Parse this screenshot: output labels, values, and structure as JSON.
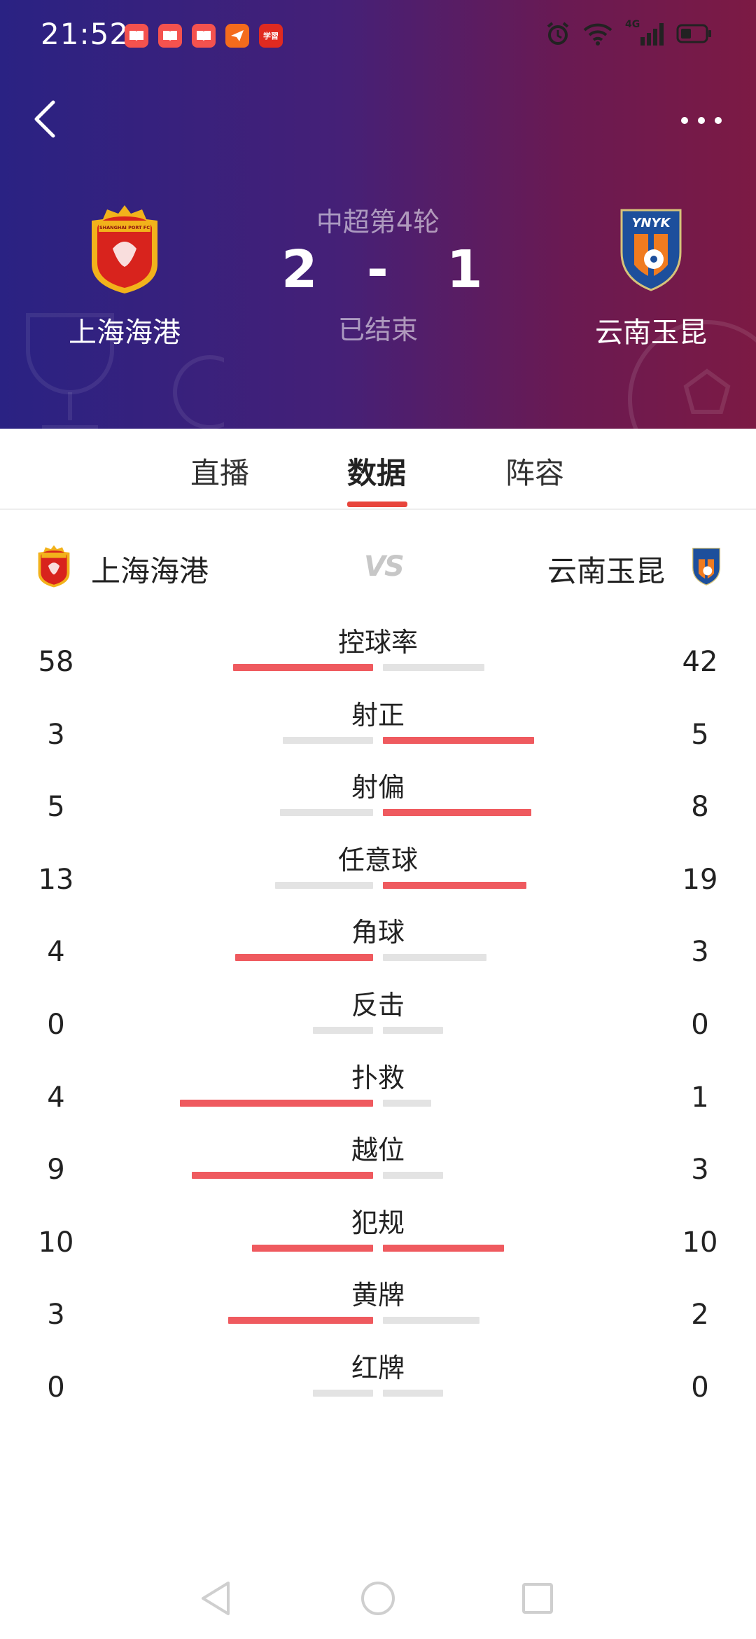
{
  "status_bar": {
    "time": "21:52",
    "app_icons": [
      "book-app-icon",
      "book-app-icon",
      "book-app-icon",
      "send-app-icon",
      "study-app-icon"
    ],
    "study_icon_text": "学習",
    "network": "4G"
  },
  "header": {
    "round": "中超第4轮",
    "home_score": "2",
    "dash": "-",
    "away_score": "1",
    "status": "已结束",
    "home_team": "上海海港",
    "away_team": "云南玉昆",
    "home_crest_text": "SHANGHAI PORT FC",
    "away_crest_text": "YNYK"
  },
  "tabs": [
    {
      "label": "直播",
      "active": false
    },
    {
      "label": "数据",
      "active": true
    },
    {
      "label": "阵容",
      "active": false
    }
  ],
  "comparison": {
    "home_team": "上海海港",
    "vs": "VS",
    "away_team": "云南玉昆"
  },
  "stats": [
    {
      "label": "控球率",
      "home": 58,
      "away": 42,
      "home_bar": 0.58,
      "away_bar": 0.42
    },
    {
      "label": "射正",
      "home": 3,
      "away": 5,
      "home_bar": 0.375,
      "away_bar": 0.625
    },
    {
      "label": "射偏",
      "home": 5,
      "away": 8,
      "home_bar": 0.385,
      "away_bar": 0.615
    },
    {
      "label": "任意球",
      "home": 13,
      "away": 19,
      "home_bar": 0.406,
      "away_bar": 0.594
    },
    {
      "label": "角球",
      "home": 4,
      "away": 3,
      "home_bar": 0.571,
      "away_bar": 0.429
    },
    {
      "label": "反击",
      "home": 0,
      "away": 0,
      "home_bar": 0.25,
      "away_bar": 0.25
    },
    {
      "label": "扑救",
      "home": 4,
      "away": 1,
      "home_bar": 0.8,
      "away_bar": 0.2
    },
    {
      "label": "越位",
      "home": 9,
      "away": 3,
      "home_bar": 0.75,
      "away_bar": 0.25
    },
    {
      "label": "犯规",
      "home": 10,
      "away": 10,
      "home_bar": 0.5,
      "away_bar": 0.5
    },
    {
      "label": "黄牌",
      "home": 3,
      "away": 2,
      "home_bar": 0.6,
      "away_bar": 0.4
    },
    {
      "label": "红牌",
      "home": 0,
      "away": 0,
      "home_bar": 0.25,
      "away_bar": 0.25
    }
  ],
  "colors": {
    "accent": "#e8453c",
    "bar_lead": "#ef5a5f",
    "bar_trail": "#e3e3e3",
    "header_left": "#2a2283",
    "header_right": "#7c1a44"
  }
}
